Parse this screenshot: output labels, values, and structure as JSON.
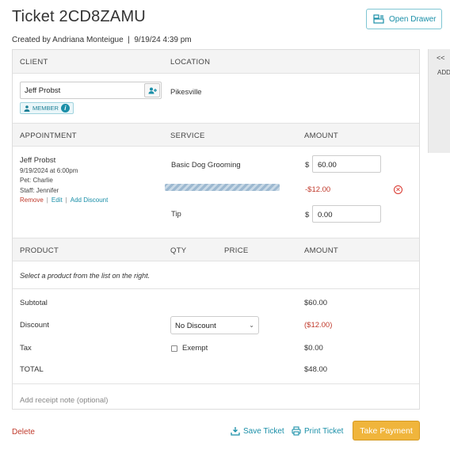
{
  "header": {
    "title": "Ticket 2CD8ZAMU",
    "created": "Created by Andriana Monteigue  |  9/19/24 4:39 pm",
    "open_drawer": "Open Drawer"
  },
  "client_section": {
    "col_client": "CLIENT",
    "col_location": "LOCATION",
    "client_name": "Jeff Probst",
    "member_badge": "MEMBER",
    "location": "Pikesville"
  },
  "appointment_section": {
    "col_appointment": "APPOINTMENT",
    "col_service": "SERVICE",
    "col_amount": "AMOUNT",
    "client_name": "Jeff Probst",
    "date": "9/19/2024 at 6:00pm",
    "pet": "Pet: Charlie",
    "staff": "Staff: Jennifer",
    "remove": "Remove",
    "edit": "Edit",
    "add_discount": "Add Discount",
    "service_name": "Basic Dog Grooming",
    "service_amount": "60.00",
    "discount_amount": "-$12.00",
    "tip_label": "Tip",
    "tip_amount": "0.00",
    "currency": "$"
  },
  "product_section": {
    "col_product": "PRODUCT",
    "col_qty": "QTY",
    "col_price": "PRICE",
    "col_amount": "AMOUNT",
    "empty_message": "Select a product from the list on the right."
  },
  "totals": {
    "subtotal_label": "Subtotal",
    "subtotal": "$60.00",
    "discount_label": "Discount",
    "discount_select": "No Discount",
    "discount": "($12.00)",
    "tax_label": "Tax",
    "exempt_label": "Exempt",
    "tax": "$0.00",
    "total_label": "TOTAL",
    "total": "$48.00"
  },
  "receipt_note_placeholder": "Add receipt note (optional)",
  "footer": {
    "delete": "Delete",
    "save_ticket": "Save Ticket",
    "print_ticket": "Print Ticket",
    "take_payment": "Take Payment"
  },
  "side_tab": {
    "chevron": "<<",
    "label": "ADD ITEMS"
  },
  "colors": {
    "accent": "#1a8fa8",
    "danger": "#c0392b",
    "payment": "#f0b53c"
  }
}
